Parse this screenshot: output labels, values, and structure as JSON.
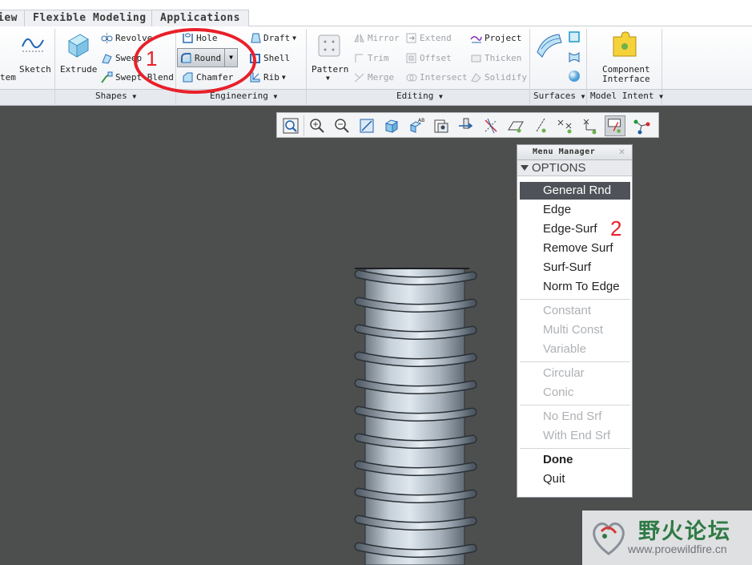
{
  "tabs": [
    "iew",
    "Flexible Modeling",
    "Applications"
  ],
  "ribbon": {
    "system_label": "tem",
    "sketch": "Sketch",
    "extrude": "Extrude",
    "revolve": "Revolve",
    "sweep": "Sweep",
    "swept_blend": "Swept Blend",
    "hole": "Hole",
    "round": "Round",
    "chamfer": "Chamfer",
    "draft": "Draft",
    "shell": "Shell",
    "rib": "Rib",
    "pattern": "Pattern",
    "mirror": "Mirror",
    "trim": "Trim",
    "merge": "Merge",
    "extend": "Extend",
    "offset": "Offset",
    "intersect": "Intersect",
    "project": "Project",
    "thicken": "Thicken",
    "solidify": "Solidify",
    "component_interface_1": "Component",
    "component_interface_2": "Interface",
    "groups": {
      "shapes": "Shapes",
      "engineering": "Engineering",
      "editing": "Editing",
      "surfaces": "Surfaces",
      "model_intent": "Model Intent"
    }
  },
  "menu_manager": {
    "title": "Menu Manager",
    "section": "OPTIONS",
    "items": {
      "general_rnd": "General Rnd",
      "edge": "Edge",
      "edge_surf": "Edge-Surf",
      "remove_surf": "Remove Surf",
      "surf_surf": "Surf-Surf",
      "norm_to_edge": "Norm To Edge",
      "constant": "Constant",
      "multi_const": "Multi Const",
      "variable": "Variable",
      "circular": "Circular",
      "conic": "Conic",
      "no_end_srf": "No End Srf",
      "with_end_srf": "With End Srf",
      "done": "Done",
      "quit": "Quit"
    }
  },
  "annotations": {
    "step1": "1",
    "step2": "2"
  },
  "watermark": {
    "text": "野火论坛",
    "url": "www.proewildfire.cn"
  },
  "colors": {
    "annotation": "#e8202a",
    "viewport": "#4d4e4e",
    "menu_selected": "#4f5258",
    "watermark_green": "#2f7a45"
  }
}
